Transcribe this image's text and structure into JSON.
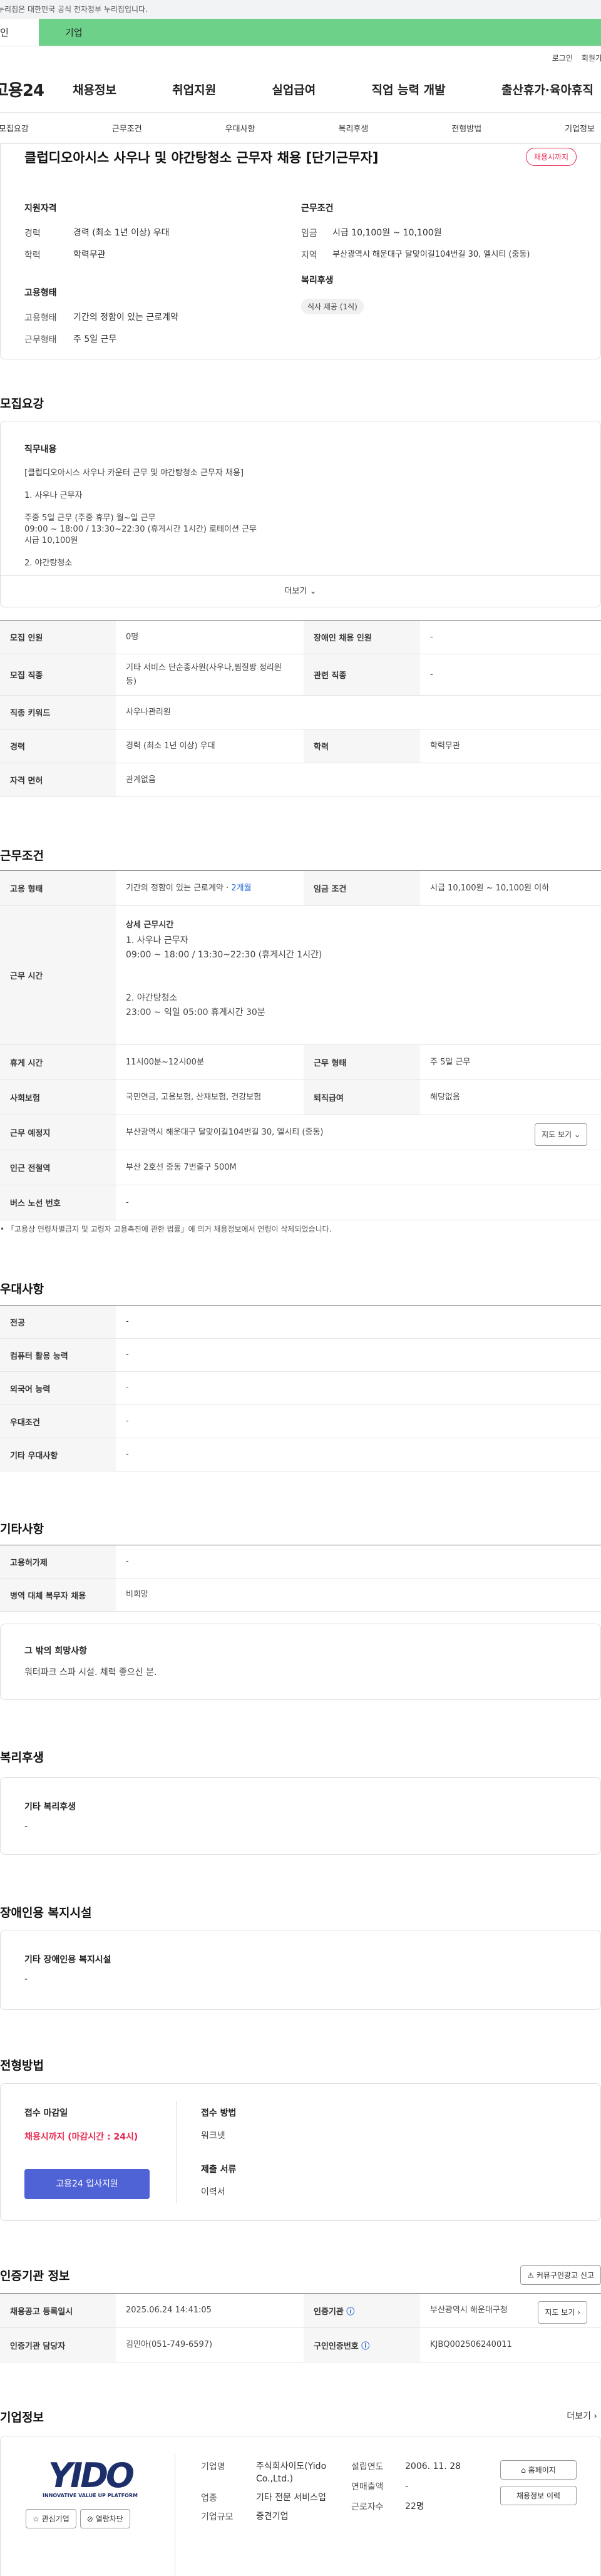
{
  "top": {
    "gov_notice": "누리집은 대한민국 공식 전자정부 누리집입니다.",
    "tab_personal": "인",
    "tab_company": "기업"
  },
  "util": {
    "login": "로그인",
    "join": "회원가"
  },
  "gnb": {
    "logo": "고용24",
    "menu": [
      "채용정보",
      "취업지원",
      "실업급여",
      "직업 능력 개발",
      "출산휴가·육아휴직"
    ]
  },
  "snb": [
    "모집요강",
    "근무조건",
    "우대사항",
    "복리후생",
    "전형방법",
    "기업정보"
  ],
  "summary": {
    "title": "클럽디오아시스 사우나 및 야간탕청소 근무자 채용 [단기근무자]",
    "status": "채용시까지",
    "qual_h": "지원자격",
    "cond_h": "근무조건",
    "career_k": "경력",
    "career_v": "경력 (최소 1년 이상) 우대",
    "edu_k": "학력",
    "edu_v": "학력무관",
    "wage_k": "임금",
    "wage_v": "시급 10,100원 ~ 10,100원",
    "region_k": "지역",
    "region_v": "부산광역시 해운대구 달맞이길104번길 30, 엘시티 (중동)",
    "emp_h": "고용형태",
    "welfare_h": "복리후생",
    "emptype_k": "고용형태",
    "emptype_v": "기간의 정함이 있는 근로계약",
    "worktype_k": "근무형태",
    "worktype_v": "주 5일 근무",
    "welfare_chip": "식사 제공 (1식)"
  },
  "recruit": {
    "title": "모집요강",
    "duty_h": "직무내용",
    "duty_lines": [
      "[클럽디오아시스 사우나 카운터 근무 및 야간탕청소 근무자 채용]",
      "",
      "1. 사우나 근무자",
      "",
      "주중 5일 근무 (주중 휴무) 월~일 근무",
      "09:00 ~ 18:00 / 13:30~22:30 (휴게시간 1시간) 로테이션 근무",
      "시급 10,100원",
      "",
      "2. 야간탕청소"
    ],
    "more": "더보기",
    "rows": [
      {
        "k1": "모집 인원",
        "v1": "0명",
        "k2": "장애인 채용 인원",
        "v2": "-"
      },
      {
        "k1": "모집 직종",
        "v1": "기타 서비스 단순종사원(사우나,찜질방 정리원 등)",
        "k2": "관련 직종",
        "v2": "-"
      },
      {
        "k1": "직종 키워드",
        "v1": "사우나관리원"
      },
      {
        "k1": "경력",
        "v1": "경력 (최소 1년 이상) 우대",
        "k2": "학력",
        "v2": "학력무관"
      },
      {
        "k1": "자격 면허",
        "v1": "관계없음"
      }
    ]
  },
  "work": {
    "title": "근무조건",
    "emp_k": "고용 형태",
    "emp_v": "기간의 정함이 있는 근로계약 · ",
    "emp_v2": "2개월",
    "wage_k": "임금 조건",
    "wage_v": "시급 10,100원 ~ 10,100원 이하",
    "time_k": "근무 시간",
    "time_h": "상세 근무시간",
    "time_lines": [
      "1. 사우나 근무자",
      "09:00 ~ 18:00 / 13:30~22:30 (휴게시간 1시간)",
      "",
      "",
      "2. 야간탕청소",
      "23:00 ~ 익일 05:00 휴게시간 30분"
    ],
    "rest_k": "휴게 시간",
    "rest_v": "11시00분~12시00분",
    "form_k": "근무 형태",
    "form_v": "주 5일 근무",
    "ins_k": "사회보험",
    "ins_v": "국민연금, 고용보험, 산재보험, 건강보험",
    "ret_k": "퇴직급여",
    "ret_v": "해당없음",
    "loc_k": "근무 예정지",
    "loc_v": "부산광역시 해운대구 달맞이길104번길 30, 엘시티 (중동)",
    "map": "지도 보기",
    "sub_k": "인근 전철역",
    "sub_v": "부산 2호선 중동 7번출구 500M",
    "bus_k": "버스 노선 번호",
    "bus_v": "-",
    "note": "「고용상 연령차별금지 및 고령자 고용촉진에 관한 법률」에 의거 채용정보에서 연령이 삭제되었습니다."
  },
  "pref": {
    "title": "우대사항",
    "rows": [
      [
        "전공",
        "-"
      ],
      [
        "컴퓨터 활용 능력",
        "-"
      ],
      [
        "외국어 능력",
        "-"
      ],
      [
        "우대조건",
        "-"
      ],
      [
        "기타 우대사항",
        "-"
      ]
    ]
  },
  "etc": {
    "title": "기타사항",
    "rows": [
      [
        "고용허가제",
        "-"
      ],
      [
        "병역 대체 복무자 채용",
        "비희망"
      ]
    ],
    "wish_h": "그 밖의 희망사항",
    "wish_v": "워터파크 스파 시설. 체력 좋으신 분."
  },
  "welfare": {
    "title": "복리후생",
    "h": "기타 복리후생",
    "v": "-"
  },
  "disab": {
    "title": "장애인용 복지시설",
    "h": "기타 장애인용 복지시설",
    "v": "-"
  },
  "select": {
    "title": "전형방법",
    "deadline_h": "접수 마감일",
    "deadline_v": "채용시까지 (마감시간 : 24시)",
    "apply": "고용24 입사지원",
    "method_h": "접수 방법",
    "method_v": "워크넷",
    "docs_h": "제출 서류",
    "docs_v": "이력서"
  },
  "cert": {
    "title": "인증기관 정보",
    "copy": "커뮤구인광고 신고",
    "r1k1": "채용공고 등록일시",
    "r1v1": "2025.06.24 14:41:05",
    "r1k2": "인증기관",
    "r1v2": "부산광역시 해운대구청",
    "map": "지도 보기",
    "r2k1": "인증기관 담당자",
    "r2v1": "김민아(051-749-6597)",
    "r2k2": "구인인증번호",
    "r2v2": "KJBQ002506240011"
  },
  "company": {
    "title": "기업정보",
    "more": "더보기",
    "logo": "YIDO",
    "logo_sub": "INNOVATIVE VALUE UP PLATFORM",
    "fav": "관심기업",
    "block": "열람차단",
    "name_k": "기업명",
    "name_v": "주식회사이도(Yido Co.,Ltd.)",
    "ind_k": "업종",
    "ind_v": "기타 전문 서비스업",
    "size_k": "기업규모",
    "size_v": "중견기업",
    "est_k": "설립연도",
    "est_v": "2006. 11. 28",
    "sales_k": "연매출액",
    "sales_v": "-",
    "emp_k": "근로자수",
    "emp_v": "22명",
    "home": "홈페이지",
    "list": "채용정보 이력"
  }
}
